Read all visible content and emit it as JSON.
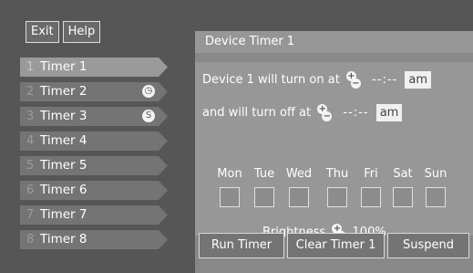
{
  "top_buttons": {
    "exit": "Exit",
    "help": "Help"
  },
  "timers": [
    {
      "number": "1",
      "label": "Timer 1",
      "selected": true,
      "icon": ""
    },
    {
      "number": "2",
      "label": "Timer 2",
      "selected": false,
      "icon": "clock-icon"
    },
    {
      "number": "3",
      "label": "Timer 3",
      "selected": false,
      "icon": "suspend-icon"
    },
    {
      "number": "4",
      "label": "Timer 4",
      "selected": false,
      "icon": ""
    },
    {
      "number": "5",
      "label": "Timer 5",
      "selected": false,
      "icon": ""
    },
    {
      "number": "6",
      "label": "Timer 6",
      "selected": false,
      "icon": ""
    },
    {
      "number": "7",
      "label": "Timer 7",
      "selected": false,
      "icon": ""
    },
    {
      "number": "8",
      "label": "Timer 8",
      "selected": false,
      "icon": ""
    }
  ],
  "panel": {
    "title": "Device Timer 1",
    "on_label": "Device 1 will turn on at",
    "on_time": "--:--",
    "on_ampm": "am",
    "off_label": "and will turn off at",
    "off_time": "--:--",
    "off_ampm": "am",
    "days": [
      "Mon",
      "Tue",
      "Wed",
      "Thu",
      "Fri",
      "Sat",
      "Sun"
    ],
    "brightness_label": "Brightness",
    "brightness_value": "100%"
  },
  "bottom_buttons": {
    "run": "Run Timer",
    "clear": "Clear Timer 1",
    "suspend": "Suspend"
  },
  "icons": {
    "plus": "+",
    "minus": "−",
    "clock": "◷",
    "suspend": "S"
  }
}
